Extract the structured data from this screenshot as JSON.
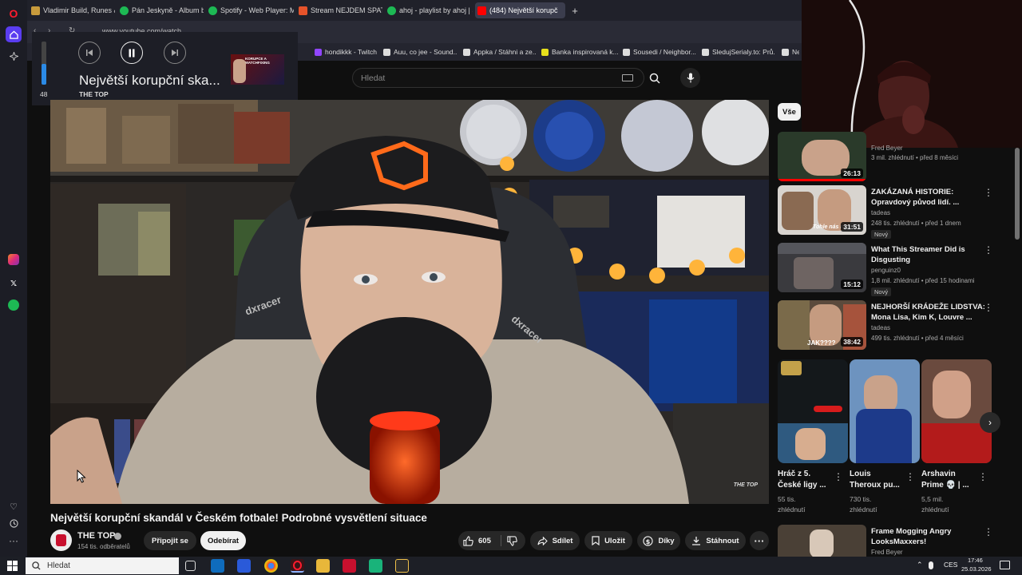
{
  "tabs": [
    {
      "label": "Vladimir Build, Runes & C"
    },
    {
      "label": "Pán Jeskyně - Album by F"
    },
    {
      "label": "Spotify - Web Player: Mus"
    },
    {
      "label": "Stream NEJDEM SPAT👏 ●"
    },
    {
      "label": "ahoj - playlist by ahoj | Sp"
    },
    {
      "label": "(484) Největší korupč"
    }
  ],
  "address": {
    "url": "www.youtube.com/watch"
  },
  "bookmarks": [
    {
      "label": "hondikkk - Twitch"
    },
    {
      "label": "Auu, co jee - Sound..."
    },
    {
      "label": "Appka / Stáhni a ze..."
    },
    {
      "label": "Banka inspirovaná k..."
    },
    {
      "label": "Sousedi / Neighbor..."
    },
    {
      "label": "SledujSerialy.to: Prů..."
    },
    {
      "label": "Ne"
    }
  ],
  "mini_player": {
    "volume": "48",
    "volume_level": 0.48,
    "title": "Největší korupční ska...",
    "channel": "THE TOP",
    "thumb_text": "KORUPCE A MATCHFIXING"
  },
  "search": {
    "placeholder": "Hledat"
  },
  "filter_chip": "Vše",
  "video": {
    "title": "Největší korupční skandál v Českém fotbale! Podrobné vysvětlení situace",
    "watermark": "THE TOP",
    "chair_brand": "dxracer"
  },
  "channel": {
    "name": "THE TOP",
    "subscribers": "154 tis. odběratelů",
    "join_label": "Připojit se",
    "subscribe_label": "Odebírat"
  },
  "actions": {
    "likes": "605",
    "share": "Sdílet",
    "save": "Uložit",
    "thanks": "Díky",
    "download": "Stáhnout"
  },
  "recommendations": [
    {
      "title": "",
      "channel": "Fred Beyer",
      "meta": "3 mil. zhlédnutí • před 8 měsíci",
      "duration": "26:13",
      "badge": ""
    },
    {
      "title": "ZAKÁZANÁ HISTORIE: Opravdový původ lidí. ...",
      "channel": "tadeas",
      "meta": "248 tis. zhlédnutí • před 1 dnem",
      "duration": "31:51",
      "badge": "Nový"
    },
    {
      "title": "What This Streamer Did is Disgusting",
      "channel": "penguinz0",
      "meta": "1,8 mil. zhlédnutí • před 15 hodinami",
      "duration": "15:12",
      "badge": "Nový"
    },
    {
      "title": "NEJHORŠÍ KRÁDEŽE LIDSTVA: Mona Lisa, Kim K, Louvre ...",
      "channel": "tadeas",
      "meta": "499 tis. zhlédnutí • před 4 měsíci",
      "duration": "38:42",
      "badge": ""
    },
    {
      "title": "Frame Mogging Angry LooksMaxxers!",
      "channel": "Fred Beyer",
      "meta": "",
      "duration": "",
      "badge": ""
    }
  ],
  "shorts": [
    {
      "title": "Hráč z 5. České ligy ...",
      "views": "55 tis.",
      "views2": "zhlédnutí"
    },
    {
      "title": "Louis Theroux pu...",
      "views": "730 tis.",
      "views2": "zhlédnutí"
    },
    {
      "title": "Arshavin Prime 💀 | ...",
      "views": "5,5 mil.",
      "views2": "zhlédnutí"
    }
  ],
  "thumb_texts": {
    "r2": "Tohle nás neu",
    "r4": "JAK????"
  },
  "taskbar": {
    "search": "Hledat",
    "lang": "CES",
    "time": "17:46",
    "date": "25.03.2026"
  },
  "colors": {
    "accent_red": "#ff0000",
    "bg": "#0f0f0f",
    "panel": "#272727"
  }
}
